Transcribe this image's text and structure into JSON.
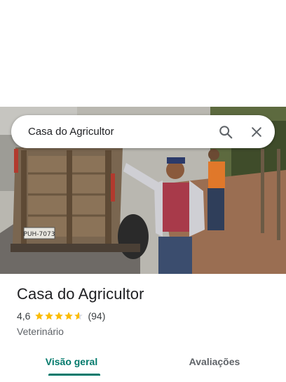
{
  "search": {
    "query": "Casa do Agricultor"
  },
  "photo": {
    "plate": "PUH-7073"
  },
  "place": {
    "title": "Casa do Agricultor",
    "rating": "4,6",
    "stars": 4.6,
    "reviews": "(94)",
    "category": "Veterinário"
  },
  "tabs": [
    {
      "label": "Visão geral"
    },
    {
      "label": "Avaliações"
    }
  ],
  "colors": {
    "accent": "#00796b",
    "star": "#fbbc04",
    "star_empty": "#dadce0"
  }
}
